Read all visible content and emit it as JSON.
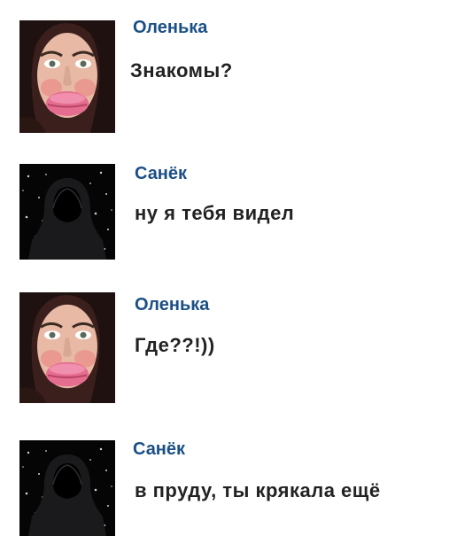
{
  "colors": {
    "author": "#1b4f86",
    "text": "#222222",
    "background": "#ffffff"
  },
  "messages": [
    {
      "author": "Оленька",
      "text": "Знакомы?",
      "avatar": "woman-photo"
    },
    {
      "author": "Санёк",
      "text": "ну я тебя видел",
      "avatar": "hooded-figure"
    },
    {
      "author": "Оленька",
      "text": "Где??!))",
      "avatar": "woman-photo"
    },
    {
      "author": "Санёк",
      "text": "в пруду, ты крякала ещё",
      "avatar": "hooded-figure"
    }
  ]
}
